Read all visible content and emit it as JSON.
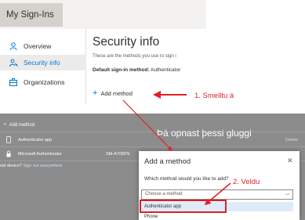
{
  "header": {
    "tab_label": "My Sign-Ins"
  },
  "sidebar": {
    "items": [
      {
        "label": "Overview",
        "icon": "person-icon",
        "active": false
      },
      {
        "label": "Security info",
        "icon": "key-person-icon",
        "active": true
      },
      {
        "label": "Organizations",
        "icon": "briefcase-icon",
        "active": false
      }
    ]
  },
  "main": {
    "title": "Security info",
    "subtitle": "These are the methods you use to sign i",
    "default_method_label": "Default sign-in method:",
    "default_method_value": "Authenticator",
    "add_method_label": "Add method"
  },
  "annotations": {
    "step1": "1.  Smelltu á",
    "step2": "2.  Veldu",
    "overlay_message": "Þá opnast þessi gluggi",
    "highlight_color": "#e0202a"
  },
  "background_page": {
    "add_method_label": "Add method",
    "rows": [
      {
        "icon": "phone-icon",
        "name": "Authenticator app",
        "phone": "",
        "action": "Delete"
      },
      {
        "icon": "lock-icon",
        "name": "Microsoft Authenticator",
        "phone": "SM-A705FN",
        "action": ""
      }
    ],
    "lost_device_text": "ost device?",
    "sign_out_link": "Sign out everywhere"
  },
  "dialog": {
    "title": "Add a method",
    "question": "Which method would you like to add?",
    "select_placeholder": "Choose a method",
    "options": [
      "Authenticator app",
      "Phone"
    ]
  },
  "colors": {
    "accent": "#0078d4",
    "annotation": "#e0202a",
    "overlay": "#8c8c8c"
  }
}
